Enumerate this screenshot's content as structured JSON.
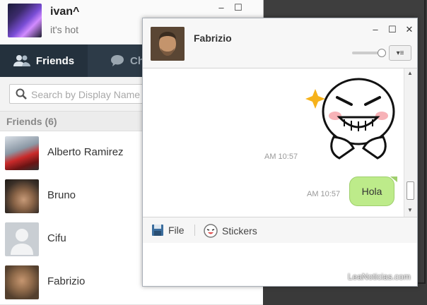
{
  "profile": {
    "name": "ivan^",
    "status": "it's hot"
  },
  "tabs": {
    "friends_label": "Friends",
    "chats_label": "Chats"
  },
  "search": {
    "placeholder": "Search by Display Name"
  },
  "friends": {
    "header": "Friends (6)",
    "items": [
      {
        "name": "Alberto Ramirez"
      },
      {
        "name": "Bruno"
      },
      {
        "name": "Cifu"
      },
      {
        "name": "Fabrizio"
      }
    ]
  },
  "chat": {
    "contact_name": "Fabrizio",
    "messages": [
      {
        "type": "sticker",
        "time": "AM 10:57"
      },
      {
        "type": "text",
        "text": "Hola",
        "time": "AM 10:57"
      }
    ]
  },
  "toolbar": {
    "file_label": "File",
    "stickers_label": "Stickers"
  },
  "watermark": "LeaNoticias.com",
  "colors": {
    "tab_bar": "#2d3b48",
    "active_tab": "#24313d",
    "bubble": "#bdeb8a"
  }
}
